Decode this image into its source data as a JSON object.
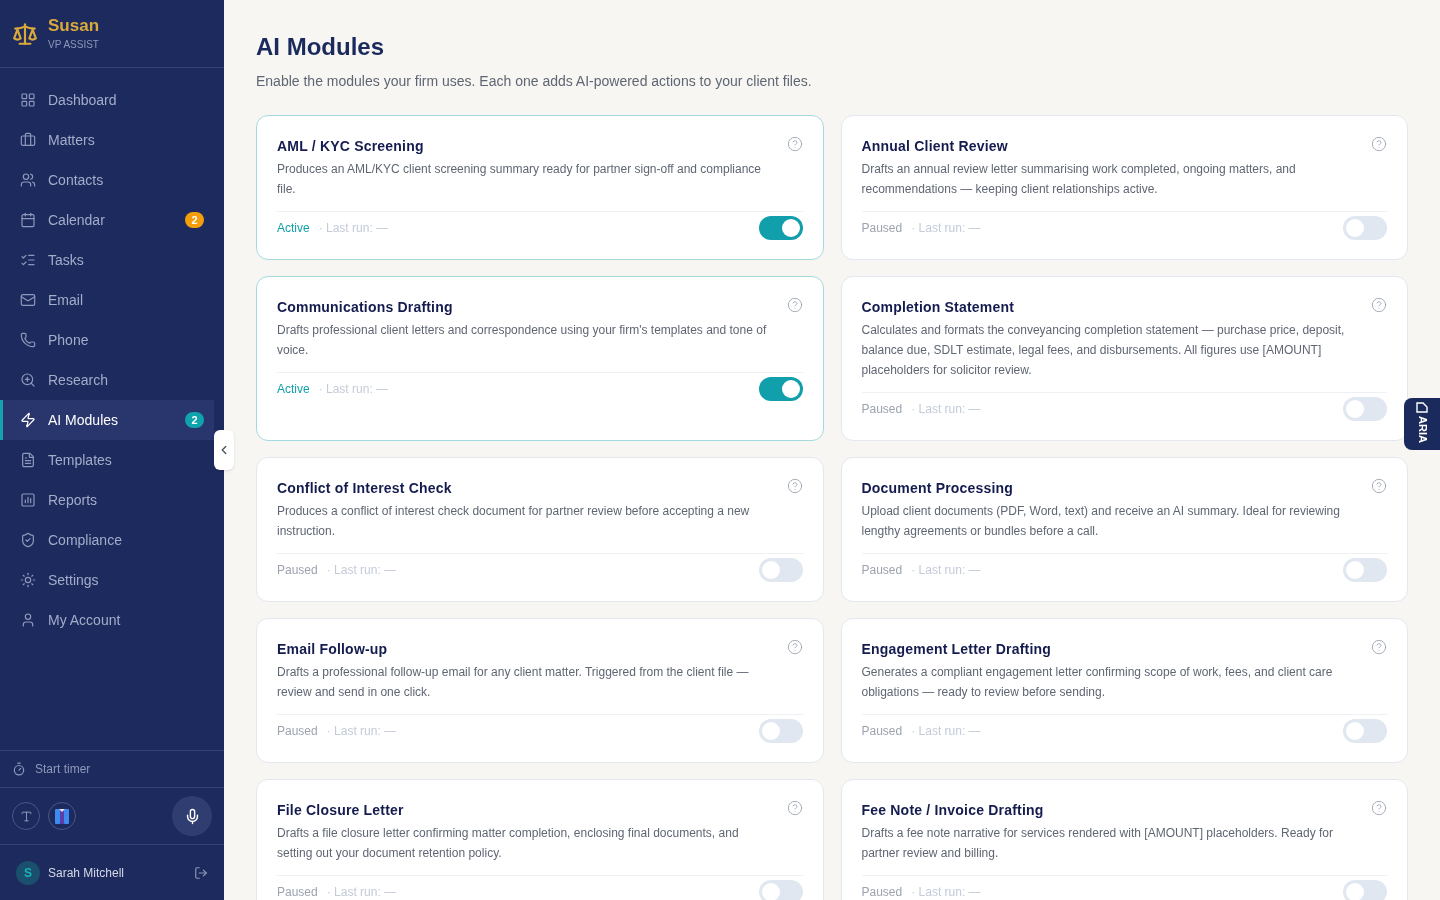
{
  "sidebar": {
    "brand": {
      "name": "Susan",
      "tagline": "VP ASSIST"
    },
    "items": [
      {
        "label": "Dashboard",
        "selected": false
      },
      {
        "label": "Matters",
        "selected": false
      },
      {
        "label": "Contacts",
        "selected": false
      },
      {
        "label": "Calendar",
        "selected": false,
        "badge": {
          "text": "2",
          "color": "#f59e0b"
        }
      },
      {
        "label": "Tasks",
        "selected": false
      },
      {
        "label": "Email",
        "selected": false
      },
      {
        "label": "Phone",
        "selected": false
      },
      {
        "label": "Research",
        "selected": false
      },
      {
        "label": "AI Modules",
        "selected": true,
        "badge": {
          "text": "2",
          "color": "#0fa3ad"
        }
      },
      {
        "label": "Templates",
        "selected": false
      },
      {
        "label": "Reports",
        "selected": false
      },
      {
        "label": "Compliance",
        "selected": false
      },
      {
        "label": "Settings",
        "selected": false
      },
      {
        "label": "My Account",
        "selected": false
      }
    ],
    "timer": {
      "label": "Start timer"
    },
    "user": {
      "initial": "S",
      "name": "Sarah Mitchell"
    }
  },
  "page": {
    "title": "AI Modules",
    "subtitle": "Enable the modules your firm uses. Each one adds AI-powered actions to your client files."
  },
  "modules": [
    {
      "title": "AML / KYC Screening",
      "description": "Produces an AML/KYC client screening summary ready for partner sign-off and compliance file.",
      "status": "Active",
      "last_run": "· Last run: —",
      "on": true
    },
    {
      "title": "Annual Client Review",
      "description": "Drafts an annual review letter summarising work completed, ongoing matters, and recommendations — keeping client relationships active.",
      "status": "Paused",
      "last_run": "· Last run: —",
      "on": false
    },
    {
      "title": "Communications Drafting",
      "description": "Drafts professional client letters and correspondence using your firm's templates and tone of voice.",
      "status": "Active",
      "last_run": "· Last run: —",
      "on": true
    },
    {
      "title": "Completion Statement",
      "description": "Calculates and formats the conveyancing completion statement — purchase price, deposit, balance due, SDLT estimate, legal fees, and disbursements. All figures use [AMOUNT] placeholders for solicitor review.",
      "status": "Paused",
      "last_run": "· Last run: —",
      "on": false
    },
    {
      "title": "Conflict of Interest Check",
      "description": "Produces a conflict of interest check document for partner review before accepting a new instruction.",
      "status": "Paused",
      "last_run": "· Last run: —",
      "on": false
    },
    {
      "title": "Document Processing",
      "description": "Upload client documents (PDF, Word, text) and receive an AI summary. Ideal for reviewing lengthy agreements or bundles before a call.",
      "status": "Paused",
      "last_run": "· Last run: —",
      "on": false
    },
    {
      "title": "Email Follow-up",
      "description": "Drafts a professional follow-up email for any client matter. Triggered from the client file — review and send in one click.",
      "status": "Paused",
      "last_run": "· Last run: —",
      "on": false
    },
    {
      "title": "Engagement Letter Drafting",
      "description": "Generates a compliant engagement letter confirming scope of work, fees, and client care obligations — ready to review before sending.",
      "status": "Paused",
      "last_run": "· Last run: —",
      "on": false
    },
    {
      "title": "File Closure Letter",
      "description": "Drafts a file closure letter confirming matter completion, enclosing final documents, and setting out your document retention policy.",
      "status": "Paused",
      "last_run": "· Last run: —",
      "on": false
    },
    {
      "title": "Fee Note / Invoice Drafting",
      "description": "Drafts a fee note narrative for services rendered with [AMOUNT] placeholders. Ready for partner review and billing.",
      "status": "Paused",
      "last_run": "· Last run: —",
      "on": false
    }
  ],
  "aria_tab": {
    "label": "ARIA"
  }
}
